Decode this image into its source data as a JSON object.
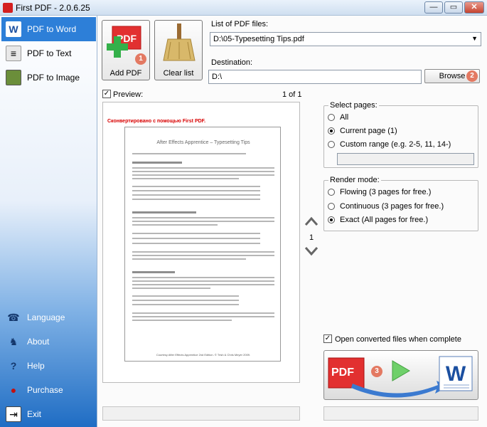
{
  "window": {
    "title": "First PDF - 2.0.6.25",
    "min_label": "—",
    "max_label": "▭",
    "close_label": "✕"
  },
  "sidebar": {
    "items": [
      {
        "label": "PDF to Word",
        "icon": "word-icon"
      },
      {
        "label": "PDF to Text",
        "icon": "text-icon"
      },
      {
        "label": "PDF to Image",
        "icon": "image-icon"
      }
    ],
    "bottom_items": [
      {
        "label": "Language",
        "icon": "language-icon"
      },
      {
        "label": "About",
        "icon": "about-icon"
      },
      {
        "label": "Help",
        "icon": "help-icon"
      },
      {
        "label": "Purchase",
        "icon": "purchase-icon"
      },
      {
        "label": "Exit",
        "icon": "exit-icon"
      }
    ]
  },
  "toolbar": {
    "add_pdf_label": "Add PDF",
    "add_badge": "1",
    "clear_list_label": "Clear list"
  },
  "files": {
    "label": "List of PDF files:",
    "selected": "D:\\05-Typesetting Tips.pdf"
  },
  "destination": {
    "label": "Destination:",
    "value": "D:\\",
    "browse_label": "Browse",
    "browse_badge": "2"
  },
  "preview": {
    "label": "Preview:",
    "checked": true,
    "page_counter": "1 of 1",
    "watermark": "Сконвертировано с помощью First PDF.",
    "doc_title": "After Effects Apprentice – Typesetting Tips",
    "doc_footer": "Courtesy After Effects Apprentice 2nd Edition. © Trish & Chris Meyer 2009.",
    "page_number": "1"
  },
  "select_pages": {
    "title": "Select pages:",
    "options": [
      "All",
      "Current page (1)",
      "Custom range (e.g. 2-5, 11, 14-)"
    ],
    "selected": 1
  },
  "render_mode": {
    "title": "Render mode:",
    "options": [
      "Flowing (3 pages for free.)",
      "Continuous (3 pages for free.)",
      "Exact (All pages for free.)"
    ],
    "selected": 2
  },
  "open_converted": {
    "label": "Open converted files when complete",
    "checked": true
  },
  "convert": {
    "pdf_label": "PDF",
    "badge": "3"
  },
  "colors": {
    "accent": "#2d7fd8",
    "badge": "#e37962",
    "pdf_red": "#d42020"
  }
}
